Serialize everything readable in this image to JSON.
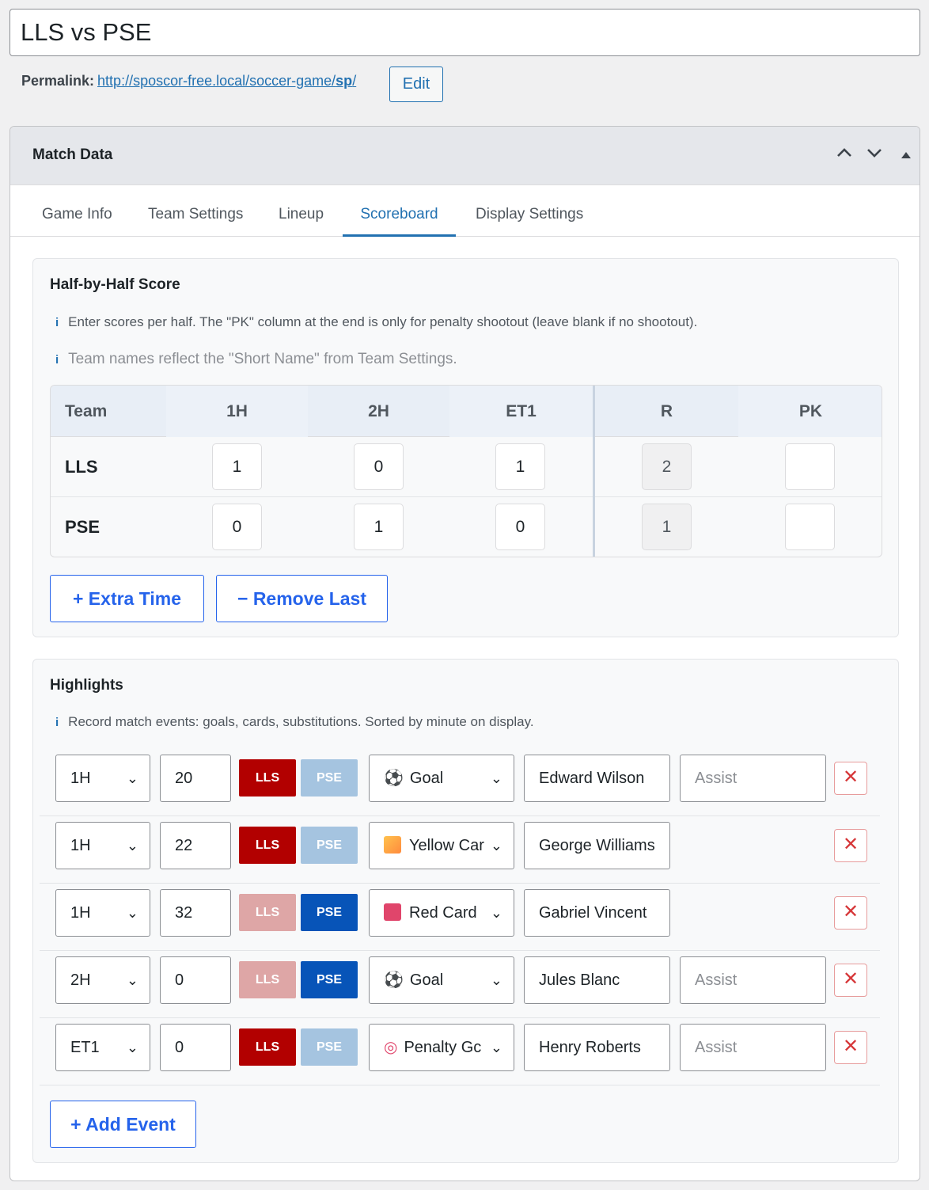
{
  "post": {
    "title": "LLS vs PSE",
    "permalink_label": "Permalink:",
    "permalink_url_base": "http://sposcor-free.local/soccer-game/",
    "permalink_slug": "sp",
    "permalink_url_tail": "/",
    "edit_label": "Edit"
  },
  "metabox": {
    "title": "Match Data",
    "tabs": [
      {
        "label": "Game Info",
        "active": false
      },
      {
        "label": "Team Settings",
        "active": false
      },
      {
        "label": "Lineup",
        "active": false
      },
      {
        "label": "Scoreboard",
        "active": true
      },
      {
        "label": "Display Settings",
        "active": false
      }
    ]
  },
  "score_panel": {
    "title": "Half-by-Half Score",
    "info_icon": "i",
    "info_1": "Enter scores per half. The \"PK\" column at the end is only for penalty shootout (leave blank if no shootout).",
    "info_2": "Team names reflect the \"Short Name\" from Team Settings.",
    "columns": [
      "Team",
      "1H",
      "2H",
      "ET1",
      "R",
      "PK"
    ],
    "rows": [
      {
        "team": "LLS",
        "h1": "1",
        "h2": "0",
        "et1": "1",
        "r": "2",
        "pk": ""
      },
      {
        "team": "PSE",
        "h1": "0",
        "h2": "1",
        "et1": "0",
        "r": "1",
        "pk": ""
      }
    ],
    "add_extra_time": "+ Extra Time",
    "remove_last": "− Remove Last"
  },
  "highlights": {
    "title": "Highlights",
    "info": "Record match events: goals, cards, substitutions. Sorted by minute on display.",
    "team_labels": {
      "home": "LLS",
      "away": "PSE"
    },
    "colors": {
      "home_active": "#b20000",
      "home_inactive": "#dea6a6",
      "away_active": "#0754b8",
      "away_inactive": "#a5c4e0"
    },
    "events": [
      {
        "period": "1H",
        "minute": "20",
        "team": "LLS",
        "type": "Goal",
        "type_icon": "soccer-ball-icon",
        "player": "Edward Wilson",
        "assist_placeholder": "Assist",
        "has_assist": true
      },
      {
        "period": "1H",
        "minute": "22",
        "team": "LLS",
        "type": "Yellow Car",
        "type_icon": "yellow-card-icon",
        "player": "George Williams",
        "has_assist": false
      },
      {
        "period": "1H",
        "minute": "32",
        "team": "PSE",
        "type": "Red Card",
        "type_icon": "red-card-icon",
        "player": "Gabriel Vincent",
        "has_assist": false
      },
      {
        "period": "2H",
        "minute": "0",
        "team": "PSE",
        "type": "Goal",
        "type_icon": "soccer-ball-icon",
        "player": "Jules Blanc",
        "assist_placeholder": "Assist",
        "has_assist": true
      },
      {
        "period": "ET1",
        "minute": "0",
        "team": "LLS",
        "type": "Penalty Gc",
        "type_icon": "target-icon",
        "player": "Henry Roberts",
        "assist_placeholder": "Assist",
        "has_assist": true
      }
    ],
    "add_event": "+ Add Event"
  }
}
